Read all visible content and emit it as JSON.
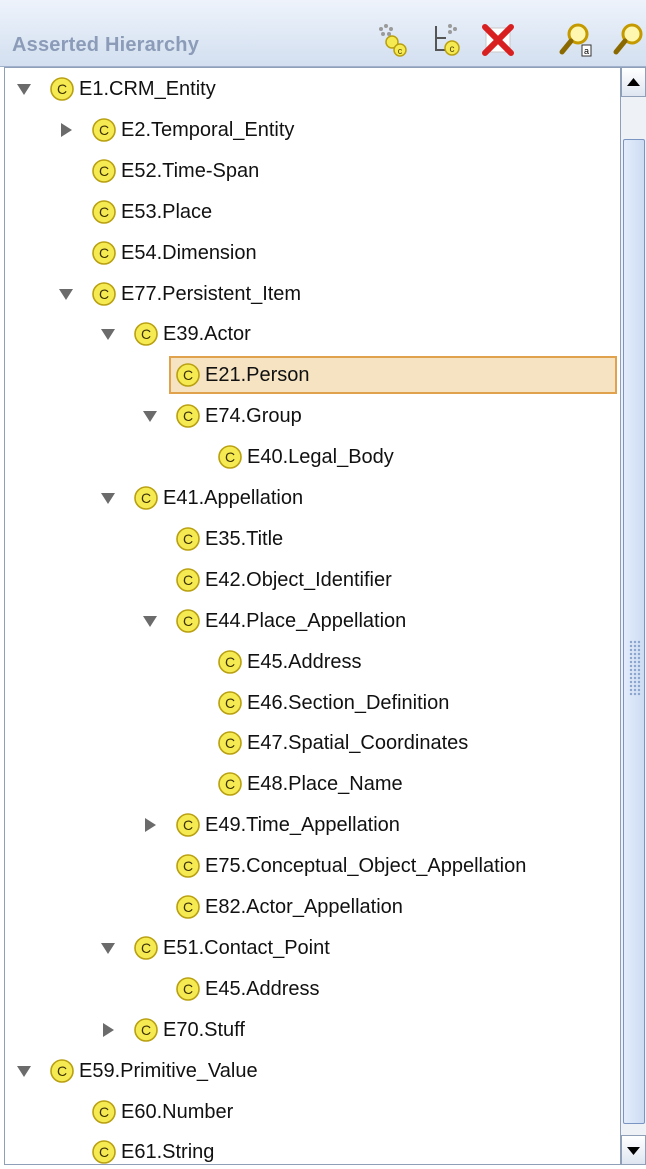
{
  "header": {
    "title": "Asserted Hierarchy"
  },
  "toolbar": [
    {
      "name": "create-subclass-button",
      "icon": "create-subclass-icon"
    },
    {
      "name": "create-sibling-class-button",
      "icon": "create-sibling-icon"
    },
    {
      "name": "delete-class-button",
      "icon": "delete-x-icon"
    },
    {
      "name": "find-class-button",
      "icon": "search-class-icon"
    },
    {
      "name": "find-class-alt-button",
      "icon": "search-class-alt-icon"
    }
  ],
  "tree": [
    {
      "label": "E1.CRM_Entity",
      "depth": 0,
      "toggle": "expanded"
    },
    {
      "label": "E2.Temporal_Entity",
      "depth": 1,
      "toggle": "collapsed"
    },
    {
      "label": "E52.Time-Span",
      "depth": 1,
      "toggle": "none"
    },
    {
      "label": "E53.Place",
      "depth": 1,
      "toggle": "none"
    },
    {
      "label": "E54.Dimension",
      "depth": 1,
      "toggle": "none"
    },
    {
      "label": "E77.Persistent_Item",
      "depth": 1,
      "toggle": "expanded"
    },
    {
      "label": "E39.Actor",
      "depth": 2,
      "toggle": "expanded"
    },
    {
      "label": "E21.Person",
      "depth": 3,
      "toggle": "none",
      "selected": true
    },
    {
      "label": "E74.Group",
      "depth": 3,
      "toggle": "expanded"
    },
    {
      "label": "E40.Legal_Body",
      "depth": 4,
      "toggle": "none"
    },
    {
      "label": "E41.Appellation",
      "depth": 2,
      "toggle": "expanded"
    },
    {
      "label": "E35.Title",
      "depth": 3,
      "toggle": "none"
    },
    {
      "label": "E42.Object_Identifier",
      "depth": 3,
      "toggle": "none"
    },
    {
      "label": "E44.Place_Appellation",
      "depth": 3,
      "toggle": "expanded"
    },
    {
      "label": "E45.Address",
      "depth": 4,
      "toggle": "none"
    },
    {
      "label": "E46.Section_Definition",
      "depth": 4,
      "toggle": "none"
    },
    {
      "label": "E47.Spatial_Coordinates",
      "depth": 4,
      "toggle": "none"
    },
    {
      "label": "E48.Place_Name",
      "depth": 4,
      "toggle": "none"
    },
    {
      "label": "E49.Time_Appellation",
      "depth": 3,
      "toggle": "collapsed"
    },
    {
      "label": "E75.Conceptual_Object_Appellation",
      "depth": 3,
      "toggle": "none"
    },
    {
      "label": "E82.Actor_Appellation",
      "depth": 3,
      "toggle": "none"
    },
    {
      "label": "E51.Contact_Point",
      "depth": 2,
      "toggle": "expanded"
    },
    {
      "label": "E45.Address",
      "depth": 3,
      "toggle": "none"
    },
    {
      "label": "E70.Stuff",
      "depth": 2,
      "toggle": "collapsed"
    },
    {
      "label": "E59.Primitive_Value",
      "depth": 0,
      "toggle": "expanded"
    },
    {
      "label": "E60.Number",
      "depth": 1,
      "toggle": "none"
    },
    {
      "label": "E61.String",
      "depth": 1,
      "toggle": "none"
    }
  ],
  "class_icon_letter": "C",
  "colors": {
    "class_icon_fill": "#f6ea52",
    "class_icon_stroke": "#b8a010",
    "selection_fill": "#f5e3c2",
    "selection_border": "#e0a24c",
    "toggle": "#6b6b6b"
  }
}
